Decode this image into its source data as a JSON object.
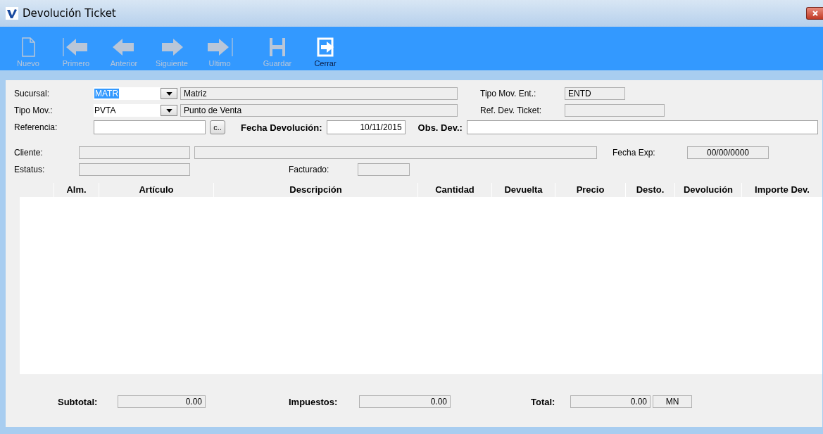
{
  "window": {
    "title": "Devolución Ticket"
  },
  "toolbar": [
    {
      "label": "Nuevo",
      "disabled": true
    },
    {
      "label": "Primero",
      "disabled": true
    },
    {
      "label": "Anterior",
      "disabled": true
    },
    {
      "label": "Siguiente",
      "disabled": true
    },
    {
      "label": "Ultimo",
      "disabled": true
    },
    {
      "label": "Guardar",
      "disabled": true
    },
    {
      "label": "Cerrar",
      "disabled": false
    }
  ],
  "form": {
    "sucursal": {
      "label": "Sucursal:",
      "value": "MATR",
      "description": "Matriz",
      "selected": true
    },
    "tipo_mov": {
      "label": "Tipo Mov.:",
      "value": "PVTA",
      "description": "Punto de Venta"
    },
    "tipo_mov_ent": {
      "label": "Tipo Mov. Ent.:",
      "value": "ENTD"
    },
    "ref_dev_ticket": {
      "label": "Ref. Dev. Ticket:"
    },
    "referencia": {
      "label": "Referencia:",
      "button": "c.."
    },
    "fecha_devolucion": {
      "label": "Fecha Devolución:",
      "value": "10/11/2015"
    },
    "obs_dev": {
      "label": "Obs. Dev.:"
    },
    "cliente": {
      "label": "Cliente:"
    },
    "fecha_exp": {
      "label": "Fecha Exp:",
      "value": "00/00/0000"
    },
    "estatus": {
      "label": "Estatus:"
    },
    "facturado": {
      "label": "Facturado:"
    }
  },
  "table": {
    "columns": [
      "Alm.",
      "Artículo",
      "Descripción",
      "Cantidad",
      "Devuelta",
      "Precio",
      "Desto.",
      "Devolución",
      "Importe Dev."
    ]
  },
  "totals": {
    "subtotal": {
      "label": "Subtotal:",
      "value": "0.00"
    },
    "impuestos": {
      "label": "Impuestos:",
      "value": "0.00"
    },
    "total": {
      "label": "Total:",
      "value": "0.00",
      "currency": "MN"
    }
  }
}
